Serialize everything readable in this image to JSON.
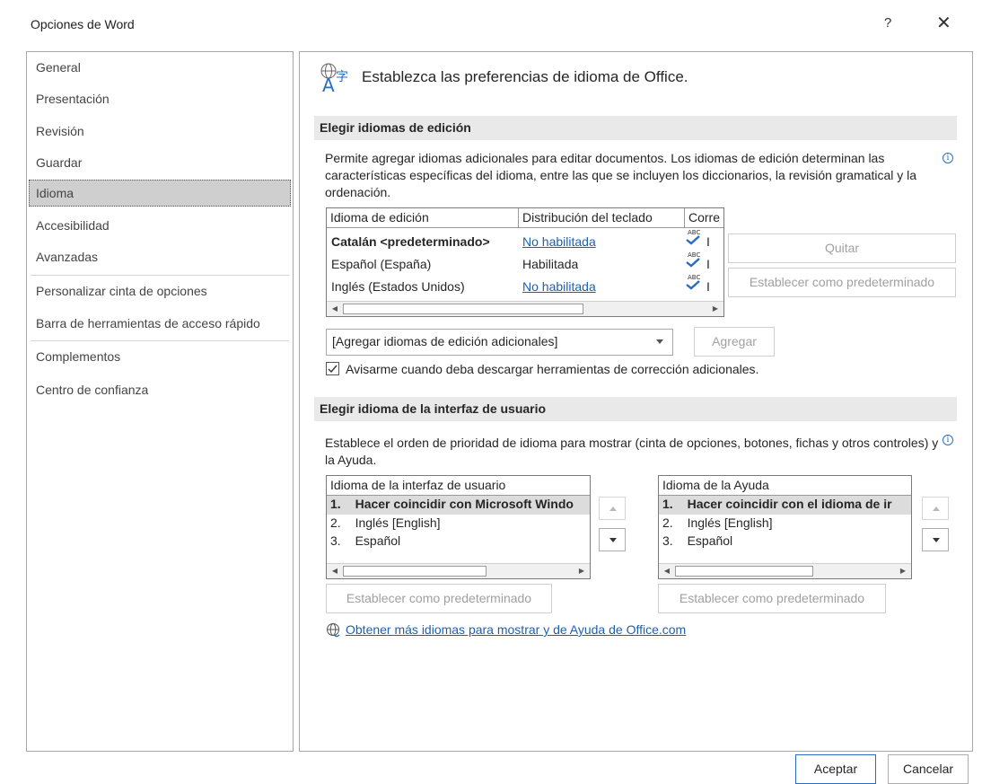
{
  "window": {
    "title": "Opciones de Word",
    "help_label": "?",
    "close_label": "✕"
  },
  "sidebar": {
    "items": [
      {
        "label": "General"
      },
      {
        "label": "Presentación"
      },
      {
        "label": "Revisión"
      },
      {
        "label": "Guardar"
      },
      {
        "label": "Idioma",
        "selected": true
      },
      {
        "label": "Accesibilidad"
      },
      {
        "label": "Avanzadas"
      },
      {
        "label": "Personalizar cinta de opciones"
      },
      {
        "label": "Barra de herramientas de acceso rápido"
      },
      {
        "label": "Complementos"
      },
      {
        "label": "Centro de confianza"
      }
    ]
  },
  "main": {
    "header_icon": "language-icon",
    "header_text": "Establezca las preferencias de idioma de Office.",
    "editing": {
      "section_title": "Elegir idiomas de edición",
      "description": "Permite agregar idiomas adicionales para editar documentos. Los idiomas de edición determinan las características específicas del idioma, entre las que se incluyen los diccionarios, la revisión gramatical y la ordenación.",
      "columns": [
        "Idioma de edición",
        "Distribución del teclado",
        "Corre"
      ],
      "rows": [
        {
          "language": "Catalán <predeterminado>",
          "keyboard": "No habilitada",
          "keyboard_link": true,
          "proofing": "I",
          "bold": true
        },
        {
          "language": "Español (España)",
          "keyboard": "Habilitada",
          "keyboard_link": false,
          "proofing": "I",
          "bold": false
        },
        {
          "language": "Inglés (Estados Unidos)",
          "keyboard": "No habilitada",
          "keyboard_link": true,
          "proofing": "I",
          "bold": false
        }
      ],
      "abc_label": "ABC",
      "remove_button": "Quitar",
      "set_default_button": "Establecer como predeterminado",
      "add_dropdown_value": "[Agregar idiomas de edición adicionales]",
      "add_button": "Agregar",
      "notify_checkbox_label": "Avisarme cuando deba descargar herramientas de corrección adicionales.",
      "notify_checked": true
    },
    "ui": {
      "section_title": "Elegir idioma de la interfaz de usuario",
      "description": "Establece el orden de prioridad de idioma para mostrar (cinta de opciones, botones, fichas y otros controles) y la Ayuda.",
      "display_list": {
        "header": "Idioma de la interfaz de usuario",
        "items": [
          {
            "num": "1.",
            "label": "Hacer coincidir con Microsoft Windo"
          },
          {
            "num": "2.",
            "label": "Inglés [English]"
          },
          {
            "num": "3.",
            "label": "Español"
          }
        ]
      },
      "help_list": {
        "header": "Idioma de la Ayuda",
        "items": [
          {
            "num": "1.",
            "label": "Hacer coincidir con el idioma de ir"
          },
          {
            "num": "2.",
            "label": "Inglés [English]"
          },
          {
            "num": "3.",
            "label": "Español"
          }
        ]
      },
      "set_default_display": "Establecer como predeterminado",
      "set_default_help": "Establecer como predeterminado",
      "more_languages_link": "Obtener más idiomas para mostrar y de Ayuda de Office.com"
    }
  },
  "footer": {
    "ok_button": "Aceptar",
    "cancel_button": "Cancelar"
  },
  "colors": {
    "link": "#1f5fb0",
    "primary_border": "#2a6dc0",
    "section_bg": "#e9e9e9",
    "selected_nav_bg": "#cfcfcf"
  }
}
